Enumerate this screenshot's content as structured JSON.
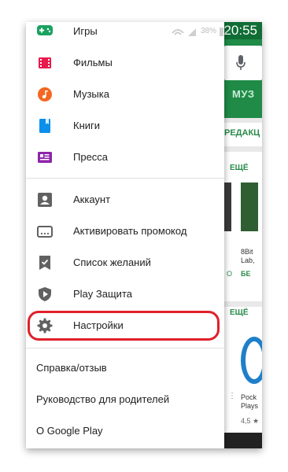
{
  "status": {
    "time": "20:55",
    "battery": "38%"
  },
  "background": {
    "tab_label": "МУЗ",
    "section_label": "РЕДАКЦ",
    "more_label_1": "ЕЩЁ",
    "more_label_2": "ЕЩЁ",
    "card1_title": "8Bit",
    "card1_sub": "Lab,",
    "card1_price": "БЕ",
    "card1_left": "О",
    "card2_title": "Pock",
    "card2_sub": "Plays",
    "card2_rating": "4,5 ★"
  },
  "drawer": {
    "top_item": "Игры",
    "group1": [
      {
        "label": "Фильмы",
        "icon": "film-icon",
        "color": "#e8194c"
      },
      {
        "label": "Музыка",
        "icon": "music-icon",
        "color": "#f46723"
      },
      {
        "label": "Книги",
        "icon": "book-icon",
        "color": "#0b8fea"
      },
      {
        "label": "Пресса",
        "icon": "newsstand-icon",
        "color": "#8e24aa"
      }
    ],
    "group2": [
      {
        "label": "Аккаунт",
        "icon": "account-icon"
      },
      {
        "label": "Активировать промокод",
        "icon": "redeem-icon"
      },
      {
        "label": "Список желаний",
        "icon": "wishlist-icon"
      },
      {
        "label": "Play Защита",
        "icon": "shield-icon"
      },
      {
        "label": "Настройки",
        "icon": "gear-icon"
      }
    ],
    "group3": [
      "Справка/отзыв",
      "Руководство для родителей",
      "О Google Play"
    ]
  },
  "colors": {
    "play_green": "#1f8b47",
    "highlight_red": "#e0202a"
  }
}
